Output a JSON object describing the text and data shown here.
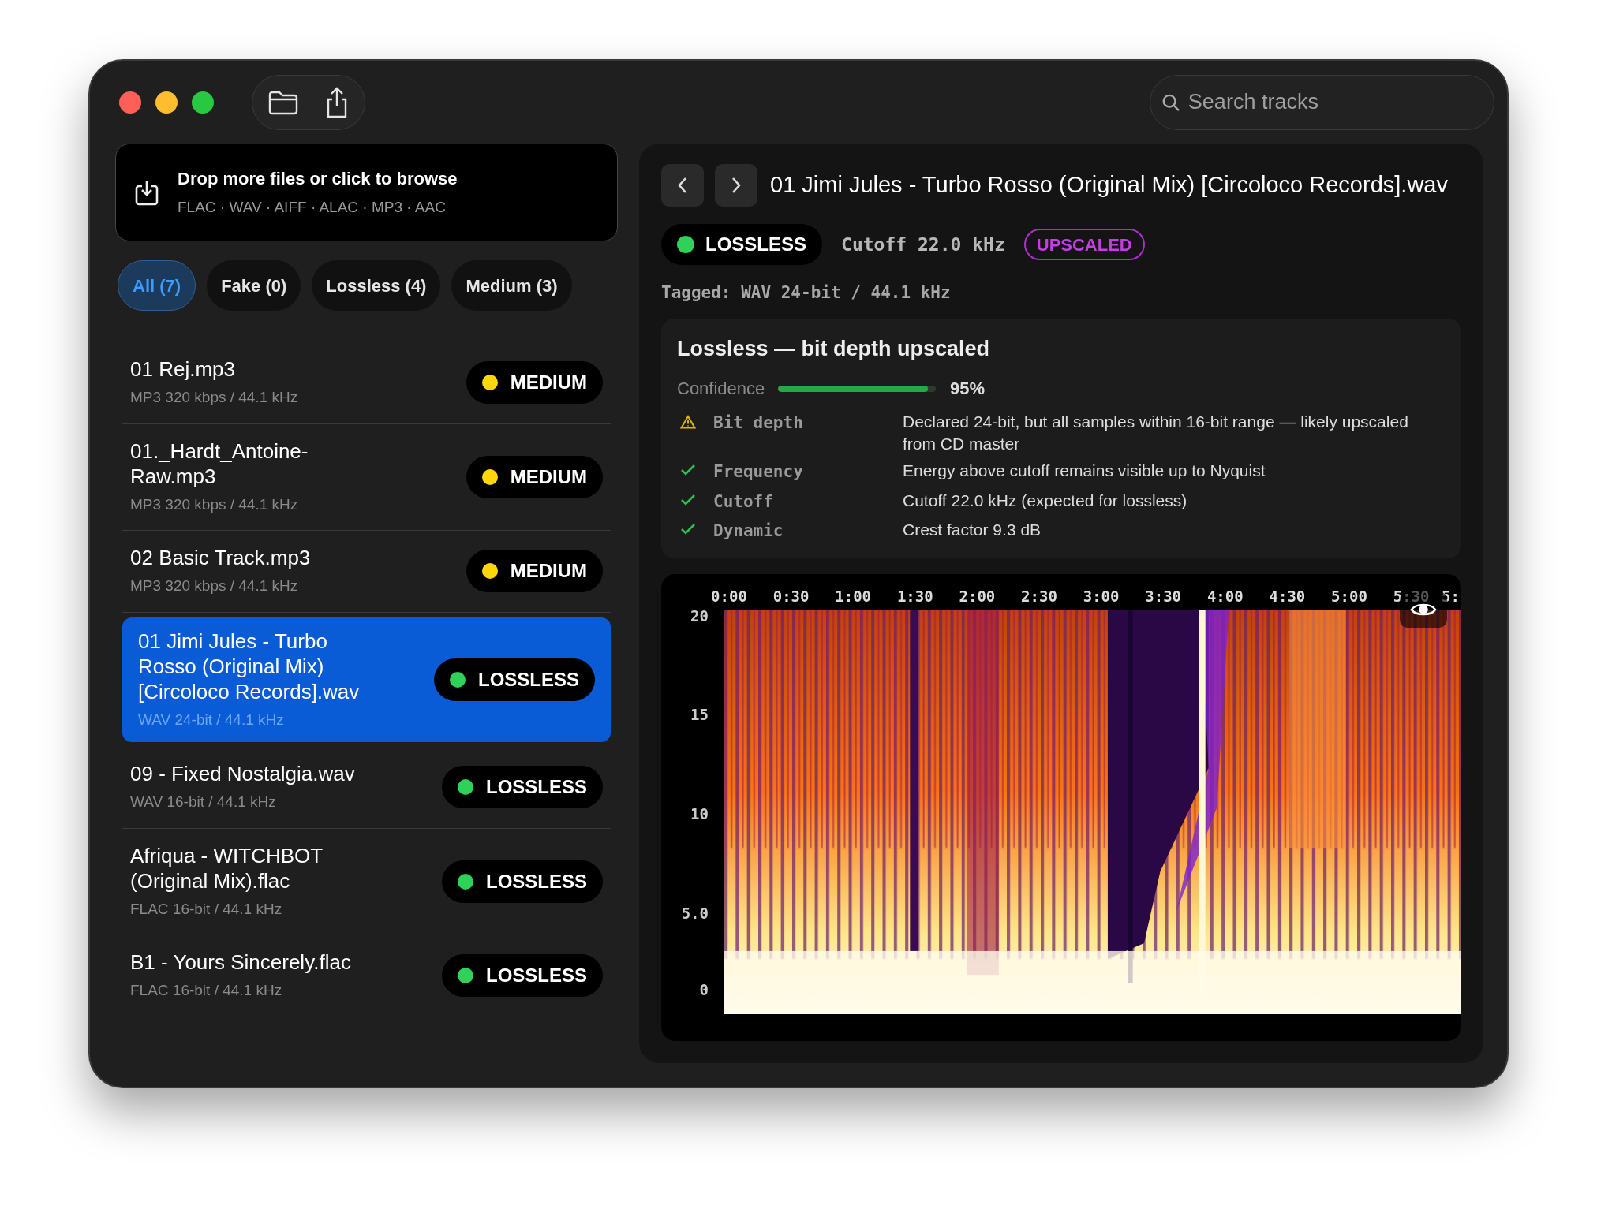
{
  "toolbar": {
    "search": {
      "placeholder": "Search tracks"
    }
  },
  "dropzone": {
    "title": "Drop more files or click to browse",
    "formats": "FLAC · WAV · AIFF · ALAC · MP3 · AAC"
  },
  "filters": [
    {
      "label": "All (7)",
      "selected": true
    },
    {
      "label": "Fake (0)",
      "selected": false
    },
    {
      "label": "Lossless (4)",
      "selected": false
    },
    {
      "label": "Medium (3)",
      "selected": false
    }
  ],
  "tracks": [
    {
      "name": "01 Rej.mp3",
      "format": "MP3 320 kbps / 44.1 kHz",
      "grade": "MEDIUM",
      "color": "#ffd60a",
      "selected": false
    },
    {
      "name": "01._Hardt_Antoine-Raw.mp3",
      "format": "MP3 320 kbps / 44.1 kHz",
      "grade": "MEDIUM",
      "color": "#ffd60a",
      "selected": false
    },
    {
      "name": "02 Basic Track.mp3",
      "format": "MP3 320 kbps / 44.1 kHz",
      "grade": "MEDIUM",
      "color": "#ffd60a",
      "selected": false
    },
    {
      "name": "01 Jimi Jules - Turbo Rosso (Original Mix) [Circoloco Records].wav",
      "format": "WAV 24-bit / 44.1 kHz",
      "grade": "LOSSLESS",
      "color": "#30d158",
      "selected": true
    },
    {
      "name": "09 - Fixed Nostalgia.wav",
      "format": "WAV 16-bit / 44.1 kHz",
      "grade": "LOSSLESS",
      "color": "#30d158",
      "selected": false
    },
    {
      "name": "Afriqua - WITCHBOT (Original Mix).flac",
      "format": "FLAC 16-bit / 44.1 kHz",
      "grade": "LOSSLESS",
      "color": "#30d158",
      "selected": false
    },
    {
      "name": "B1  - Yours Sincerely.flac",
      "format": "FLAC 16-bit / 44.1 kHz",
      "grade": "LOSSLESS",
      "color": "#30d158",
      "selected": false
    }
  ],
  "detail": {
    "title": "01 Jimi Jules - Turbo Rosso (Original Mix) [Circoloco Records].wav",
    "grade": {
      "label": "LOSSLESS",
      "color": "#30d158"
    },
    "cutoff": "Cutoff 22.0 kHz",
    "flag": "UPSCALED",
    "tagged": "Tagged: WAV 24-bit / 44.1 kHz",
    "verdict": "Lossless — bit depth upscaled",
    "confidence": {
      "label": "Confidence",
      "level": 0.95,
      "reading": "95%"
    },
    "checks": [
      {
        "kind": "warn",
        "label": "Bit depth",
        "text": "Declared 24-bit, but all samples within 16-bit range — likely upscaled from CD master"
      },
      {
        "kind": "ok",
        "label": "Frequency",
        "text": "Energy above cutoff remains visible up to Nyquist"
      },
      {
        "kind": "ok",
        "label": "Cutoff",
        "text": "Cutoff 22.0 kHz (expected for lossless)"
      },
      {
        "kind": "ok",
        "label": "Dynamic",
        "text": "Crest factor 9.3 dB"
      }
    ],
    "spectrogram": {
      "kind": "picture",
      "x_ticks": [
        "0:00",
        "0:30",
        "1:00",
        "1:30",
        "2:00",
        "2:30",
        "3:00",
        "3:30",
        "4:00",
        "4:30",
        "5:00",
        "5:30",
        "5:"
      ],
      "y_ticks": [
        "20",
        "15",
        "10",
        "5.0",
        "0"
      ]
    }
  }
}
